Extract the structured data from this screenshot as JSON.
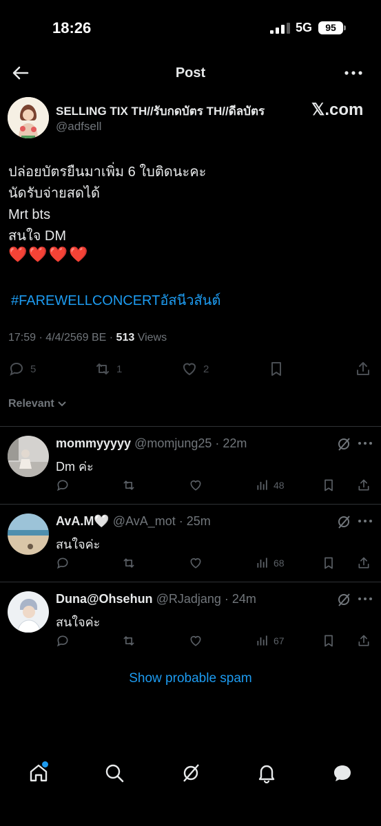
{
  "status_bar": {
    "time": "18:26",
    "network": "5G",
    "battery": "95"
  },
  "header": {
    "title": "Post"
  },
  "post": {
    "author_name": "SELLING TIX TH//รับกดบัตร TH//ดีลบัตร",
    "author_handle": "@adfsell",
    "watermark": "𝕏.com",
    "lines": [
      "ปล่อยบัตรยืนมาเพิ่ม 6 ใบติดนะคะ",
      "นัดรับจ่ายสดได้",
      "Mrt bts",
      "สนใจ DM"
    ],
    "hearts": "❤️❤️❤️❤️",
    "hashtag": "#FAREWELLCONCERTอัสนีวสันต์",
    "timestamp": "17:59 · 4/4/2569 BE · ",
    "views_count": "513",
    "views_label": " Views",
    "stats": {
      "replies": "5",
      "reposts": "1",
      "likes": "2"
    }
  },
  "sort": {
    "label": "Relevant"
  },
  "replies": [
    {
      "name": "mommyyyyy",
      "handle": "@momjung25 · 22m",
      "text": "Dm ค่ะ",
      "views": "48",
      "avatar_color": "#cfcfcf"
    },
    {
      "name": "AvA.M🤍",
      "handle": "@AvA_mot · 25m",
      "text": "สนใจค่ะ",
      "views": "68",
      "avatar_color": "#8fb7c9"
    },
    {
      "name": "Duna@Ohsehun",
      "handle": "@RJadjang · 24m",
      "text": "สนใจค่ะ",
      "views": "67",
      "avatar_color": "#dde3ea"
    }
  ],
  "spam_link": "Show probable spam",
  "nav": [
    "home-icon",
    "search-icon",
    "grok-icon",
    "notifications-icon",
    "messages-icon"
  ]
}
